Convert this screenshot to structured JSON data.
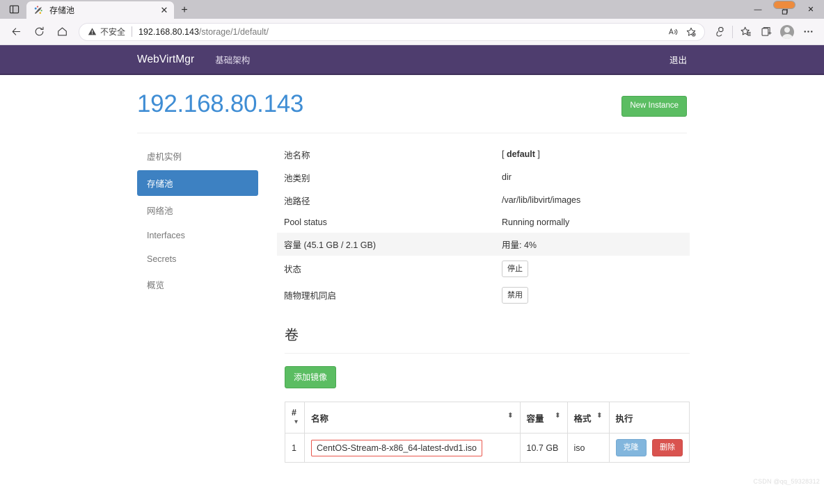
{
  "browser": {
    "taskview_icon": "task-view-icon",
    "tab": {
      "title": "存储池",
      "favicon": "webvirtmgr-favicon",
      "close_label": "✕"
    },
    "newtab_label": "+",
    "window_controls": {
      "minimize": "—",
      "restore": "❐",
      "close": "✕"
    },
    "toolbar": {
      "back_icon": "back-arrow-icon",
      "refresh_icon": "refresh-icon",
      "home_icon": "home-icon",
      "security_label": "不安全",
      "url_host": "192.168.80.143",
      "url_path": "/storage/1/default/",
      "read_aloud_icon": "read-aloud-icon",
      "favorite_icon": "add-favorite-icon",
      "split_icon": "browser-essentials-icon",
      "favorites_icon": "favorites-icon",
      "collections_icon": "collections-icon",
      "profile_icon": "profile-avatar-icon",
      "settings_icon": "settings-more-icon"
    }
  },
  "navbar": {
    "brand": "WebVirtMgr",
    "links": [
      {
        "label": "基础架构"
      }
    ],
    "logout_label": "退出",
    "color": "#4e3d6e"
  },
  "page": {
    "title": "192.168.80.143",
    "title_color": "#3f8dd4",
    "new_instance_label": "New Instance",
    "new_instance_color": "#5bbd62"
  },
  "sidebar": {
    "items": [
      {
        "label": "虚机实例",
        "active": false
      },
      {
        "label": "存储池",
        "active": true
      },
      {
        "label": "网络池",
        "active": false
      },
      {
        "label": "Interfaces",
        "active": false
      },
      {
        "label": "Secrets",
        "active": false
      },
      {
        "label": "概览",
        "active": false
      }
    ],
    "active_color": "#3d81c2"
  },
  "pool_details": {
    "rows": [
      {
        "key": "池名称",
        "value": "[ default ]",
        "value_bold": "default",
        "type": "bold-bracket",
        "striped": false
      },
      {
        "key": "池类别",
        "value": "dir",
        "type": "text",
        "striped": false
      },
      {
        "key": "池路径",
        "value": "/var/lib/libvirt/images",
        "type": "text",
        "striped": false
      },
      {
        "key": "Pool status",
        "value": "Running normally",
        "type": "text",
        "striped": false
      },
      {
        "key": "容量 (45.1 GB / 2.1 GB)",
        "value": "用量: 4%",
        "type": "text",
        "striped": true
      },
      {
        "key": "状态",
        "value": "停止",
        "type": "button",
        "striped": false
      },
      {
        "key": "随物理机同启",
        "value": "禁用",
        "type": "button",
        "striped": false
      }
    ]
  },
  "volumes": {
    "section_title": "卷",
    "add_image_label": "添加镜像",
    "add_image_color": "#5bbd62",
    "columns": [
      {
        "label": "#",
        "sort": "▾"
      },
      {
        "label": "名称",
        "sort": "⬍"
      },
      {
        "label": "容量",
        "sort": "⬍"
      },
      {
        "label": "格式",
        "sort": "⬍"
      },
      {
        "label": "执行",
        "sort": ""
      }
    ],
    "rows": [
      {
        "num": "1",
        "name": "CentOS-Stream-8-x86_64-latest-dvd1.iso",
        "capacity": "10.7 GB",
        "format": "iso",
        "clone_label": "克隆",
        "delete_label": "删除"
      }
    ],
    "highlight_color": "#e9564b",
    "clone_color": "#82b6dd",
    "delete_color": "#d9534f"
  },
  "watermark": {
    "text": "CSDN @qq_59328312"
  }
}
